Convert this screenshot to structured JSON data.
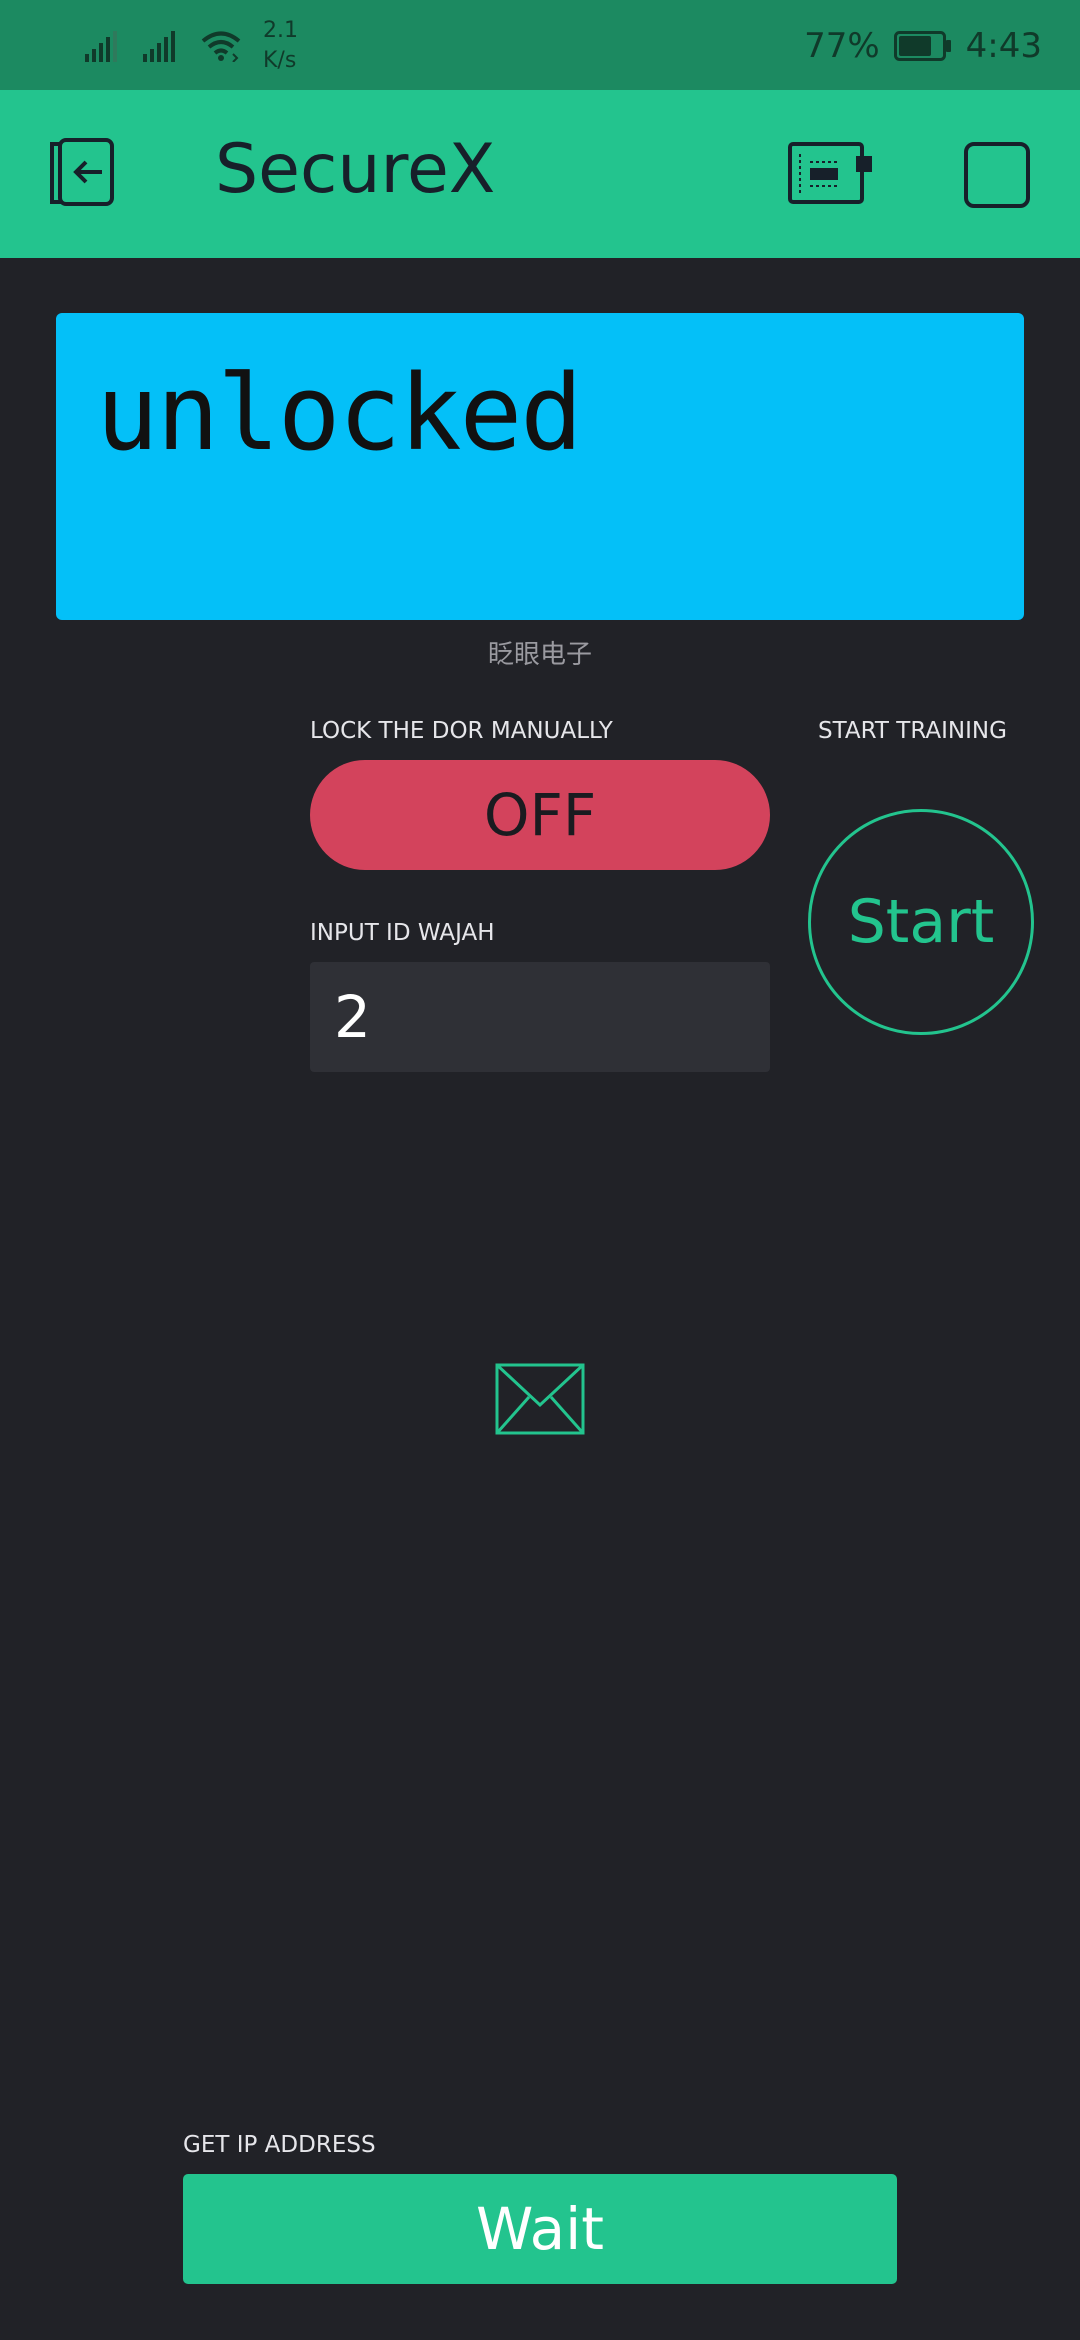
{
  "status_bar": {
    "network_speed_value": "2.1",
    "network_speed_unit": "K/s",
    "battery_percent": "77%",
    "battery_level": 0.77,
    "time": "4:43",
    "icons": [
      "signal-icon",
      "signal-icon",
      "wifi-icon",
      "battery-icon"
    ]
  },
  "app_bar": {
    "title": "SecureX",
    "icons": [
      "exit-icon",
      "device-icon",
      "square-icon"
    ]
  },
  "lcd": {
    "text": "unlocked",
    "caption": "眨眼电子",
    "background_color": "#04c0f8"
  },
  "lock_toggle": {
    "label": "LOCK THE DOR MANUALLY",
    "state_text": "OFF",
    "color": "#d3435c"
  },
  "training": {
    "label": "START TRAINING",
    "button_text": "Start"
  },
  "face_id_input": {
    "label": "INPUT ID WAJAH",
    "value": "2"
  },
  "email_widget": {
    "icon": "envelope-icon"
  },
  "ip_address": {
    "label": "GET IP ADDRESS",
    "button_text": "Wait"
  },
  "colors": {
    "accent": "#23c48e",
    "status_bar": "#1c8a61",
    "background": "#212227"
  }
}
